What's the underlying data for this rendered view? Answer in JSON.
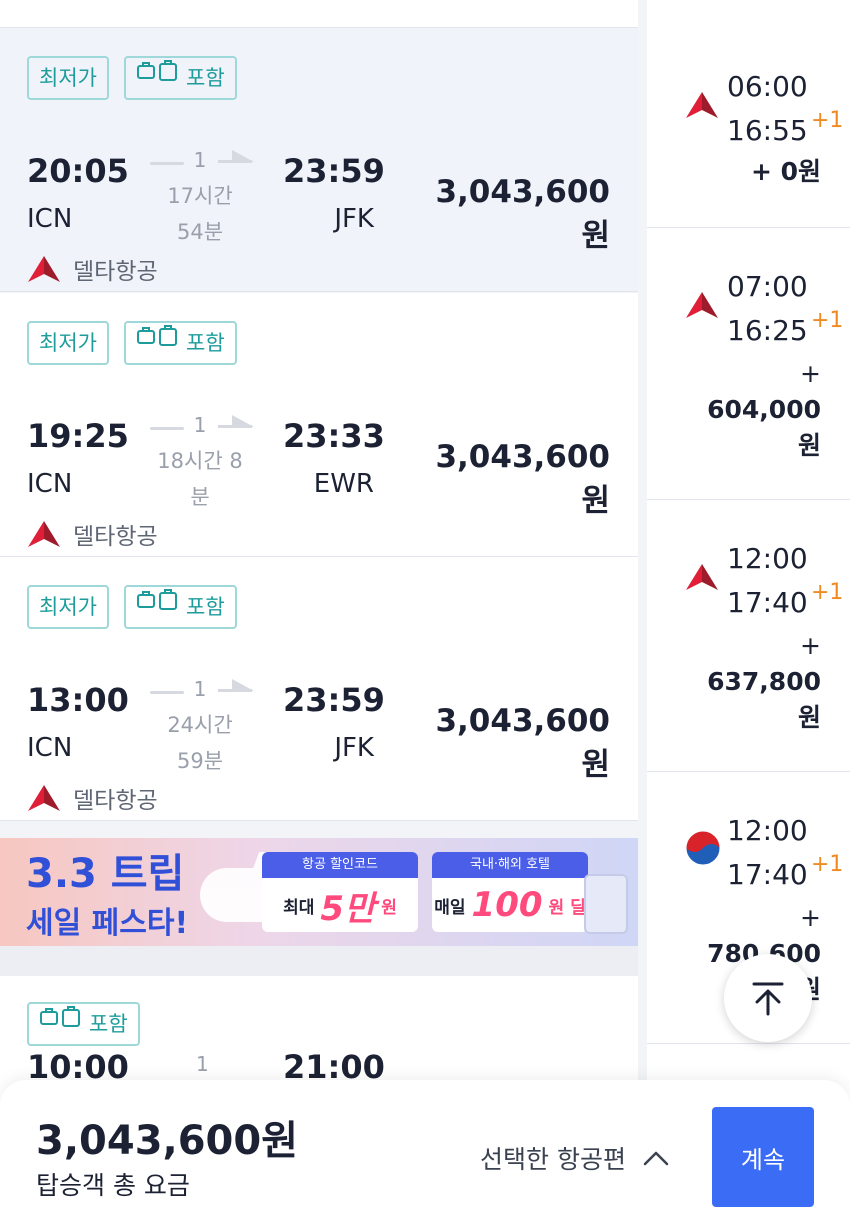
{
  "flights": [
    {
      "badges": [
        "최저가",
        "포함"
      ],
      "dep_time": "20:05",
      "dep_airport": "ICN",
      "arr_time": "23:59",
      "arr_airport": "JFK",
      "stops": "1",
      "duration_line1": "17시간",
      "duration_line2": "54분",
      "price": "3,043,600원",
      "airline": "델타항공",
      "selected": true
    },
    {
      "badges": [
        "최저가",
        "포함"
      ],
      "dep_time": "19:25",
      "dep_airport": "ICN",
      "arr_time": "23:33",
      "arr_airport": "EWR",
      "stops": "1",
      "duration_line1": "18시간 8",
      "duration_line2": "분",
      "price": "3,043,600원",
      "airline": "델타항공",
      "selected": false
    },
    {
      "badges": [
        "최저가",
        "포함"
      ],
      "dep_time": "13:00",
      "dep_airport": "ICN",
      "arr_time": "23:59",
      "arr_airport": "JFK",
      "stops": "1",
      "duration_line1": "24시간",
      "duration_line2": "59분",
      "price": "3,043,600원",
      "airline": "델타항공",
      "selected": false
    },
    {
      "badges": [
        "포함"
      ],
      "dep_time": "10:00",
      "arr_time": "21:00",
      "stops": "1"
    }
  ],
  "banner": {
    "title": "3.3 트립",
    "subtitle": "세일 페스타!",
    "coupon1_head": "항공 할인코드",
    "coupon1_pre": "최대",
    "coupon1_big": "5만",
    "coupon1_post": "원",
    "coupon2_head": "국내·해외 호텔",
    "coupon2_pre": "매일",
    "coupon2_big": "100",
    "coupon2_post": "원 딜"
  },
  "return_flights": [
    {
      "logo": "delta",
      "dep": "06:00",
      "arr": "16:55",
      "plus_day": "+1",
      "extra_line1": "+ 0원",
      "extra_line2": "",
      "extra_line3": ""
    },
    {
      "logo": "delta",
      "dep": "07:00",
      "arr": "16:25",
      "plus_day": "+1",
      "extra_line1": "+",
      "extra_line2": "604,000",
      "extra_line3": "원"
    },
    {
      "logo": "delta",
      "dep": "12:00",
      "arr": "17:40",
      "plus_day": "+1",
      "extra_line1": "+",
      "extra_line2": "637,800",
      "extra_line3": "원"
    },
    {
      "logo": "korean-air",
      "dep": "12:00",
      "arr": "17:40",
      "plus_day": "+1",
      "extra_line1": "+",
      "extra_line2": "780,600",
      "extra_line3": "원"
    }
  ],
  "footer": {
    "total_price": "3,043,600원",
    "total_label": "탑승객 총 요금",
    "selected_flights_label": "선택한 항공편",
    "continue_label": "계속"
  },
  "colors": {
    "accent": "#3b6cf5",
    "badge_teal": "#1e9c9c",
    "plus_day": "#f28a22",
    "delta_red": "#c8102e"
  }
}
